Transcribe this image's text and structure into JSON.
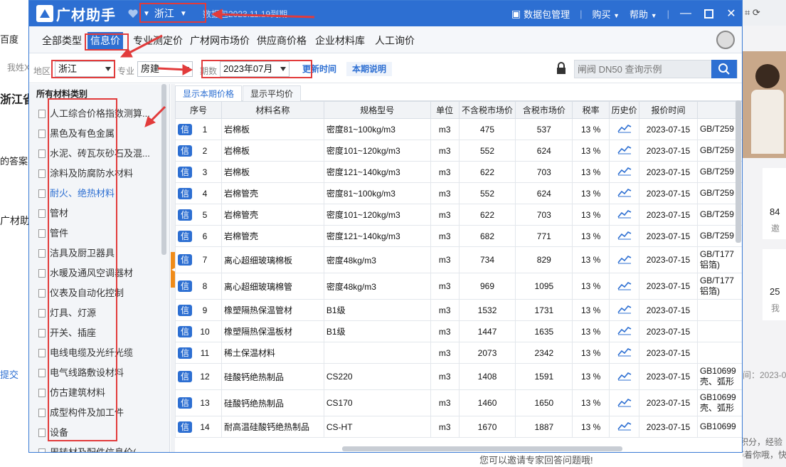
{
  "background": {
    "left_texts": [
      "百度",
      "我姓X",
      "浙江省",
      "的答案",
      "广材助手",
      "提交"
    ],
    "bottom_text": "您可以邀请专家回答问题哦!",
    "bottom_link": "邀请专家",
    "right_texts": [
      "84",
      "邀",
      "25",
      "我",
      "间：2023-0",
      "积分，经验",
      "利在等着你哦，快来签"
    ]
  },
  "titlebar": {
    "app_name": "广材助手",
    "province": "浙江",
    "expire_note": "数据包2023.11.19到期",
    "data_pack": "数据包管理",
    "buy": "购买",
    "help": "帮助"
  },
  "menu": {
    "items": [
      "全部类型",
      "信息价",
      "专业测定价",
      "广材网市场价",
      "供应商价格",
      "企业材料库",
      "人工询价"
    ]
  },
  "filter": {
    "region_label": "地区",
    "region_value": "浙江",
    "major_label": "专业",
    "major_value": "房建",
    "period_label": "期数",
    "period_value": "2023年07月",
    "update_time": "更新时间",
    "period_note": "本期说明",
    "search_placeholder": "闸阀 DN50 查询示例"
  },
  "sidebar": {
    "title": "所有材料类别",
    "items": [
      "人工综合价格指数测算...",
      "黑色及有色金属",
      "水泥、砖瓦灰砂石及混...",
      "涂料及防腐防水材料",
      "耐火、绝热材料",
      "管材",
      "管件",
      "洁具及厨卫器具",
      "水暖及通风空调器材",
      "仪表及自动化控制",
      "灯具、灯源",
      "开关、插座",
      "电线电缆及光纤光缆",
      "电气线路敷设材料",
      "仿古建筑材料",
      "成型构件及加工件",
      "设备",
      "周转材及配件信息价(..."
    ],
    "active_index": 4
  },
  "tabs": [
    "显示本期价格",
    "显示平均价"
  ],
  "table": {
    "headers": [
      "序号",
      "材料名称",
      "规格型号",
      "单位",
      "不含税市场价",
      "含税市场价",
      "税率",
      "历史价",
      "报价时间",
      ""
    ],
    "tag": "信",
    "rows": [
      {
        "no": "1",
        "name": "岩棉板",
        "spec": "密度81~100kg/m3",
        "unit": "m3",
        "price_ex": "475",
        "price_in": "537",
        "tax": "13 %",
        "date": "2023-07-15",
        "std": "GB/T259"
      },
      {
        "no": "2",
        "name": "岩棉板",
        "spec": "密度101~120kg/m3",
        "unit": "m3",
        "price_ex": "552",
        "price_in": "624",
        "tax": "13 %",
        "date": "2023-07-15",
        "std": "GB/T259"
      },
      {
        "no": "3",
        "name": "岩棉板",
        "spec": "密度121~140kg/m3",
        "unit": "m3",
        "price_ex": "622",
        "price_in": "703",
        "tax": "13 %",
        "date": "2023-07-15",
        "std": "GB/T259"
      },
      {
        "no": "4",
        "name": "岩棉管壳",
        "spec": "密度81~100kg/m3",
        "unit": "m3",
        "price_ex": "552",
        "price_in": "624",
        "tax": "13 %",
        "date": "2023-07-15",
        "std": "GB/T259"
      },
      {
        "no": "5",
        "name": "岩棉管壳",
        "spec": "密度101~120kg/m3",
        "unit": "m3",
        "price_ex": "622",
        "price_in": "703",
        "tax": "13 %",
        "date": "2023-07-15",
        "std": "GB/T259"
      },
      {
        "no": "6",
        "name": "岩棉管壳",
        "spec": "密度121~140kg/m3",
        "unit": "m3",
        "price_ex": "682",
        "price_in": "771",
        "tax": "13 %",
        "date": "2023-07-15",
        "std": "GB/T259"
      },
      {
        "no": "7",
        "name": "离心超细玻璃棉板",
        "spec": "密度48kg/m3",
        "unit": "m3",
        "price_ex": "734",
        "price_in": "829",
        "tax": "13 %",
        "date": "2023-07-15",
        "std": "GB/T177 铝箔)"
      },
      {
        "no": "8",
        "name": "离心超细玻璃棉管",
        "spec": "密度48kg/m3",
        "unit": "m3",
        "price_ex": "969",
        "price_in": "1095",
        "tax": "13 %",
        "date": "2023-07-15",
        "std": "GB/T177 铝箔)"
      },
      {
        "no": "9",
        "name": "橡塑隔热保温管材",
        "spec": "B1级",
        "unit": "m3",
        "price_ex": "1532",
        "price_in": "1731",
        "tax": "13 %",
        "date": "2023-07-15",
        "std": ""
      },
      {
        "no": "10",
        "name": "橡塑隔热保温板材",
        "spec": "B1级",
        "unit": "m3",
        "price_ex": "1447",
        "price_in": "1635",
        "tax": "13 %",
        "date": "2023-07-15",
        "std": ""
      },
      {
        "no": "11",
        "name": "稀土保温材料",
        "spec": "",
        "unit": "m3",
        "price_ex": "2073",
        "price_in": "2342",
        "tax": "13 %",
        "date": "2023-07-15",
        "std": ""
      },
      {
        "no": "12",
        "name": "硅酸钙绝热制品",
        "spec": "CS220",
        "unit": "m3",
        "price_ex": "1408",
        "price_in": "1591",
        "tax": "13 %",
        "date": "2023-07-15",
        "std": "GB10699 壳、弧形"
      },
      {
        "no": "13",
        "name": "硅酸钙绝热制品",
        "spec": "CS170",
        "unit": "m3",
        "price_ex": "1460",
        "price_in": "1650",
        "tax": "13 %",
        "date": "2023-07-15",
        "std": "GB10699 壳、弧形"
      },
      {
        "no": "14",
        "name": "耐高温硅酸钙绝热制品",
        "spec": "CS-HT",
        "unit": "m3",
        "price_ex": "1670",
        "price_in": "1887",
        "tax": "13 %",
        "date": "2023-07-15",
        "std": "GB10699"
      }
    ]
  },
  "colors": {
    "brand": "#2d6fd2",
    "accent": "#f08c1a",
    "annotation": "#e23b3b"
  }
}
